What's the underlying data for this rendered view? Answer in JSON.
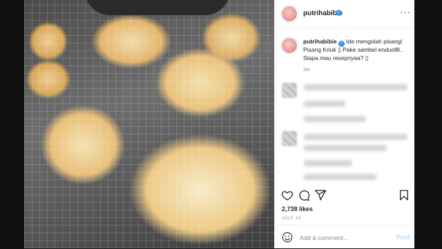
{
  "post": {
    "username": "putrihabibie",
    "caption_text": "Ide mengolah pisang! Pisang Kriuk ▯ Pake sambel enduollll.. Siapa mau resepnyaa? ▯",
    "caption_time": "3w",
    "likes": "2,738 likes",
    "date": "JULY 13"
  },
  "comment_box": {
    "placeholder": "Add a comment...",
    "post_label": "Post"
  },
  "icons": {
    "verified": "verified-badge-icon",
    "more": "more-options-icon",
    "like": "heart-icon",
    "comment": "comment-icon",
    "share": "share-icon",
    "save": "bookmark-icon",
    "emoji": "emoji-icon",
    "next": "chevron-right-icon"
  },
  "colors": {
    "verified": "#3897f0",
    "post_button": "#b2dffc"
  }
}
